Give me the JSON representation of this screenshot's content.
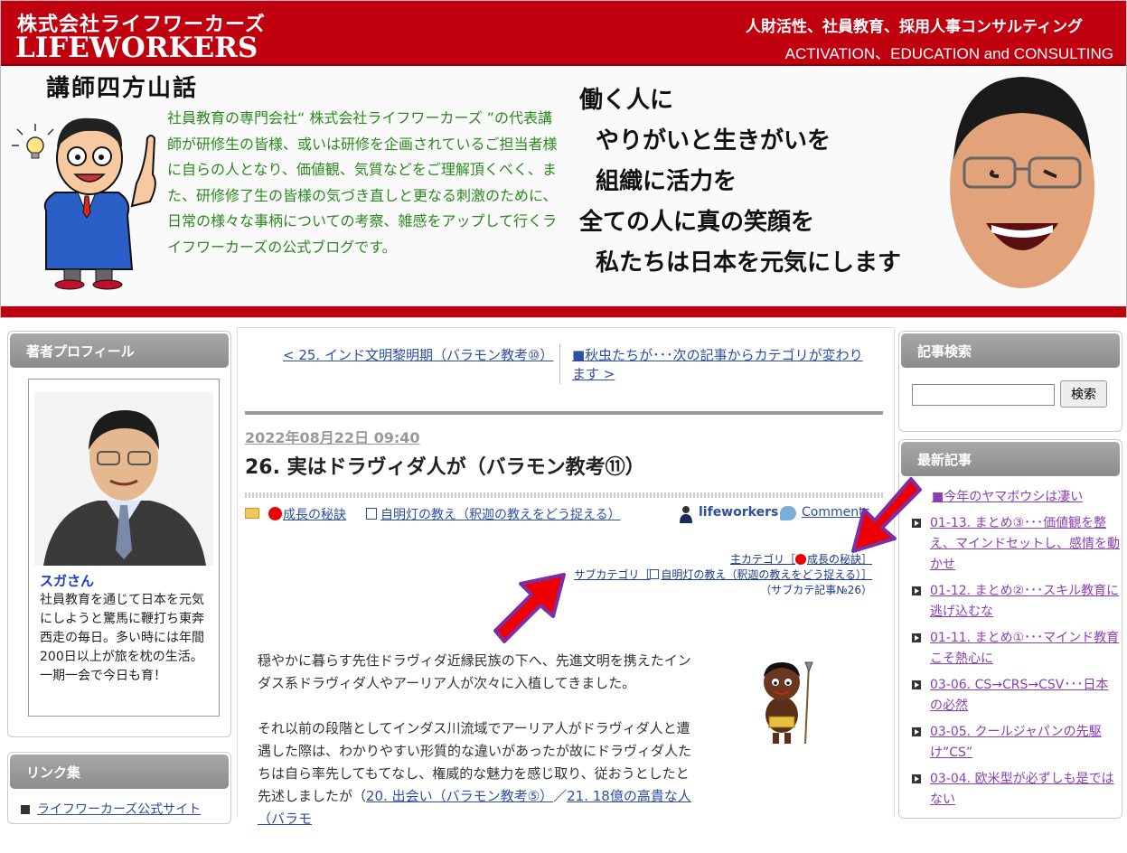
{
  "header": {
    "company_jp": "株式会社ライフワーカーズ",
    "company_en": "LIFEWORKERS",
    "tagline_jp": "人財活性、社員教育、採用人事コンサルティング",
    "tagline_en": "ACTIVATION、EDUCATION and CONSULTING",
    "blog_title": "講師四方山話",
    "intro": "社員教育の専門会社“ 株式会社ライフワーカーズ ”の代表講師が研修生の皆様、或いは研修を企画されているご担当者様に自らの人となり、価値観、気質などをご理解頂くべく、また、研修修了生の皆様の気づき直しと更なる刺激のために、日常の様々な事柄についての考察、雑感をアップして行くライフワーカーズの公式ブログです。",
    "mission": [
      "働く人に",
      "やりがいと生きがいを",
      "組織に活力を",
      "全ての人に真の笑顔を",
      "私たちは日本を元気にします"
    ]
  },
  "sidebar_left": {
    "profile_heading": "著者プロフィール",
    "profile_name": "スガさん",
    "profile_text": "社員教育を通じて日本を元気にしようと驚馬に鞭打ち東奔西走の毎日。多い時には年間200日以上が旅を枕の生活。一期一会で今日も育！",
    "links_heading": "リンク集",
    "links": [
      "ライフワーカーズ公式サイト"
    ]
  },
  "sidebar_right": {
    "search_heading": "記事検索",
    "search_button": "検索",
    "search_value": "",
    "recent_heading": "最新記事",
    "recent": [
      "■今年のヤマボウシは凄い",
      "01-13. まとめ③･･･価値観を整え、マインドセットし、感情を動かせ",
      "01-12. まとめ②･･･スキル教育に逃げ込むな",
      "01-11. まとめ①･･･マインド教育こそ熱心に",
      "03-06. CS→CRS→CSV･･･日本の必然",
      "03-05. クールジャパンの先駆け”CS”",
      "03-04. 欧米型が必ずしも是ではない"
    ]
  },
  "main": {
    "prev_link": "< 25. インド文明黎明期（バラモン教考⑩）",
    "next_link": "■秋虫たちが･･･次の記事からカテゴリが変わります >",
    "date": "2022年08月22日 09:40",
    "title": "26. 実はドラヴィダ人が（バラモン教考⑪）",
    "cat1": "成長の秘訣",
    "cat2": "自明灯の教え（釈迦の教えをどう捉える）",
    "author": "lifeworkers",
    "comments": "Comments",
    "main_cat_prefix": "主カテゴリ［",
    "main_cat_name": "成長の秘訣",
    "main_cat_suffix": "］",
    "sub_cat_prefix": "サブカテゴリ［",
    "sub_cat_name": "自明灯の教え（釈迦の教えをどう捉える）",
    "sub_cat_suffix": "］",
    "sub_cat_count": "（サブカテ記事№26）",
    "p1": "穏やかに暮らす先住ドラヴィダ近縁民族の下へ、先進文明を携えたインダス系ドラヴィダ人やアーリア人が次々に入植してきました。",
    "p2_text": "それ以前の段階としてインダス川流域でアーリア人がドラヴィダ人と遭遇した際は、わかりやすい形質的な違いがあったが故にドラヴィダ人たちは自ら率先してもてなし、権威的な魅力を感じ取り、従おうとしたと先述しましたが（",
    "p2_link1": "20. 出会い（バラモン教考⑤）",
    "p2_sep": "／",
    "p2_link2": "21. 18億の高貴な人（バラモ"
  },
  "colors": {
    "brand_red": "#c0000e",
    "link_blue": "#2d4fa0",
    "visited_purple": "#8a3fb0",
    "intro_green": "#2a8a1e",
    "arrow_red": "#ee0000",
    "arrow_outline": "#7a2fa8"
  }
}
